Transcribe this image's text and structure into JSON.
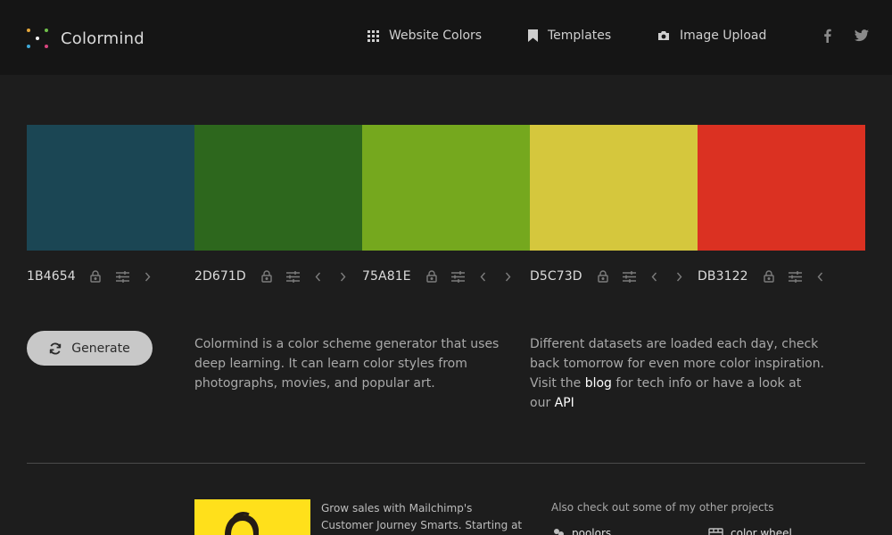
{
  "header": {
    "logo_text": "Colormind",
    "nav": [
      {
        "label": "Website Colors",
        "icon": "grid-icon"
      },
      {
        "label": "Templates",
        "icon": "bookmark-icon"
      },
      {
        "label": "Image Upload",
        "icon": "camera-icon"
      }
    ],
    "social": [
      "facebook-icon",
      "twitter-icon"
    ]
  },
  "palette": [
    {
      "hex": "1B4654",
      "color": "#1b4654"
    },
    {
      "hex": "2D671D",
      "color": "#2d671d"
    },
    {
      "hex": "75A81E",
      "color": "#75a81e"
    },
    {
      "hex": "D5C73D",
      "color": "#d5c73d"
    },
    {
      "hex": "DB3122",
      "color": "#db3122"
    }
  ],
  "generate_label": "Generate",
  "intro": {
    "text": "Colormind is a color scheme generator that uses deep learning. It can learn color styles from photographs, movies, and popular art."
  },
  "datasets": {
    "text_before": "Different datasets are loaded each day, check back tomorrow for even more color inspiration. Visit the ",
    "blog_link": "blog",
    "text_middle": " for tech info or have a look at our ",
    "api_link": "API"
  },
  "ad": {
    "text": "Grow sales with Mailchimp's Customer Journey Smarts. Starting at"
  },
  "projects": {
    "title": "Also check out some of my other projects",
    "items": [
      "poolors",
      "color wheel"
    ]
  }
}
